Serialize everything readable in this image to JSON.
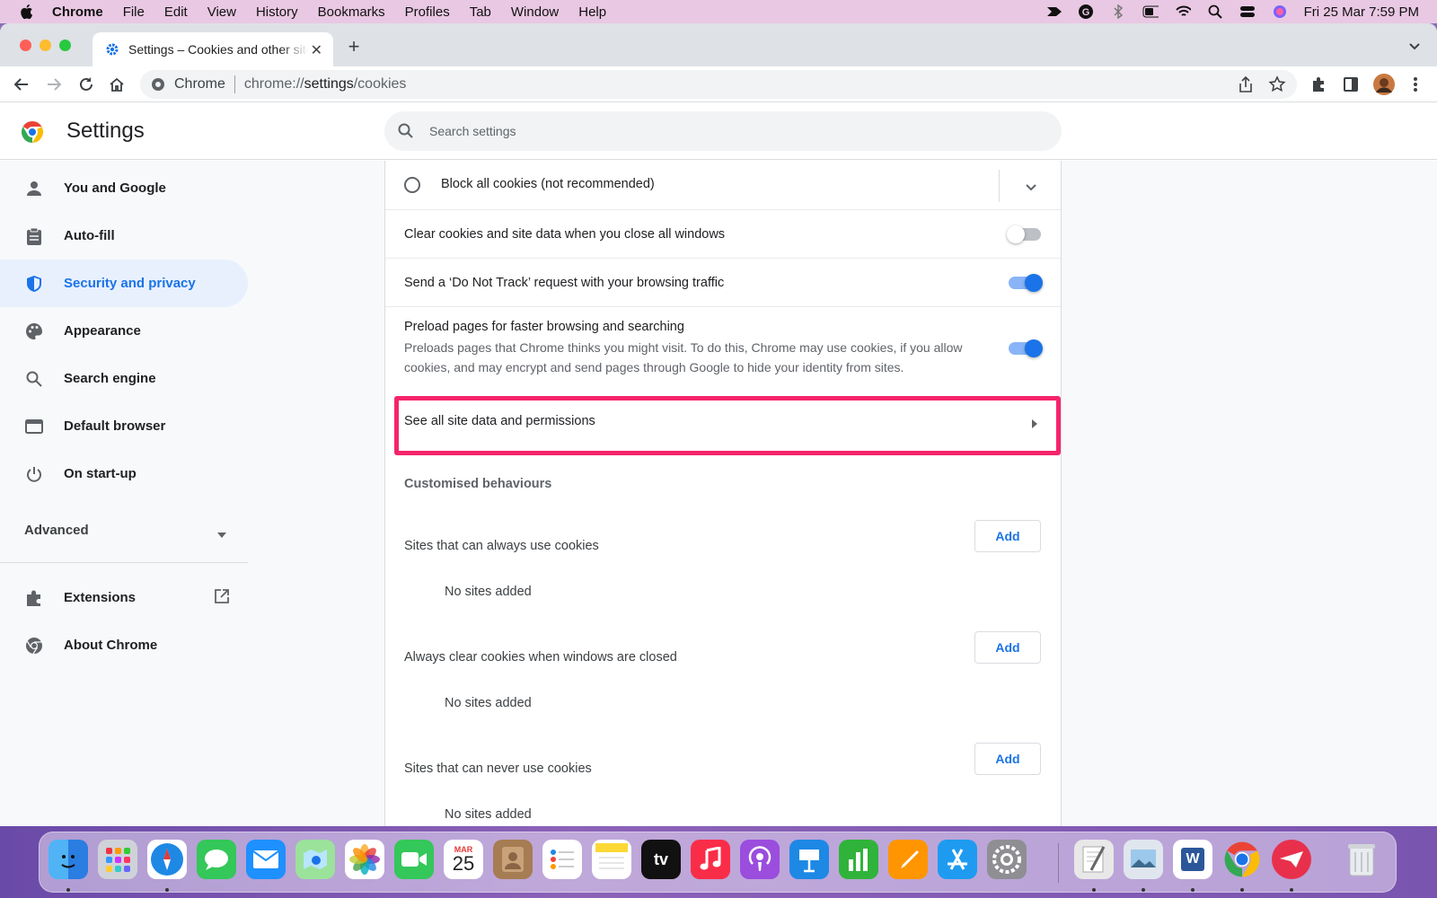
{
  "menubar": {
    "app": "Chrome",
    "items": [
      "File",
      "Edit",
      "View",
      "History",
      "Bookmarks",
      "Profiles",
      "Tab",
      "Window",
      "Help"
    ],
    "datetime": "Fri 25 Mar  7:59 PM"
  },
  "browser": {
    "tab_title": "Settings – Cookies and other site data",
    "omnibox_chip": "Chrome",
    "url_prefix": "chrome://",
    "url_host": "settings",
    "url_path": "/cookies"
  },
  "settings": {
    "title": "Settings",
    "search_placeholder": "Search settings",
    "nav": [
      {
        "label": "You and Google",
        "icon": "person-icon"
      },
      {
        "label": "Auto-fill",
        "icon": "clipboard-icon"
      },
      {
        "label": "Security and privacy",
        "icon": "shield-icon",
        "active": true
      },
      {
        "label": "Appearance",
        "icon": "palette-icon"
      },
      {
        "label": "Search engine",
        "icon": "search-icon"
      },
      {
        "label": "Default browser",
        "icon": "browser-window-icon"
      },
      {
        "label": "On start-up",
        "icon": "power-icon"
      }
    ],
    "advanced": "Advanced",
    "extensions": "Extensions",
    "about": "About Chrome"
  },
  "content": {
    "block_all": "Block all cookies (not recommended)",
    "clear_on_close": "Clear cookies and site data when you close all windows",
    "clear_on_close_on": false,
    "dnt": "Send a ‘Do Not Track’ request with your browsing traffic",
    "dnt_on": true,
    "preload_title": "Preload pages for faster browsing and searching",
    "preload_desc_1": "Preloads pages that Chrome thinks you might visit. To do this, Chrome may use cookies, if you allow",
    "preload_desc_2": "cookies, and may encrypt and send pages through Google to hide your identity from sites.",
    "preload_on": true,
    "see_all": "See all site data and permissions",
    "customised": "Customised behaviours",
    "lists": [
      {
        "label": "Sites that can always use cookies",
        "button": "Add",
        "empty": "No sites added"
      },
      {
        "label": "Always clear cookies when windows are closed",
        "button": "Add",
        "empty": "No sites added"
      },
      {
        "label": "Sites that can never use cookies",
        "button": "Add",
        "empty": "No sites added"
      }
    ]
  },
  "dock": {
    "calendar_month": "MAR",
    "calendar_day": "25",
    "tv_label": "tv",
    "word_letter": "W"
  },
  "colors": {
    "accent": "#1a73e8",
    "highlight": "#f5246a",
    "active_nav_bg": "#e8f0fe"
  }
}
